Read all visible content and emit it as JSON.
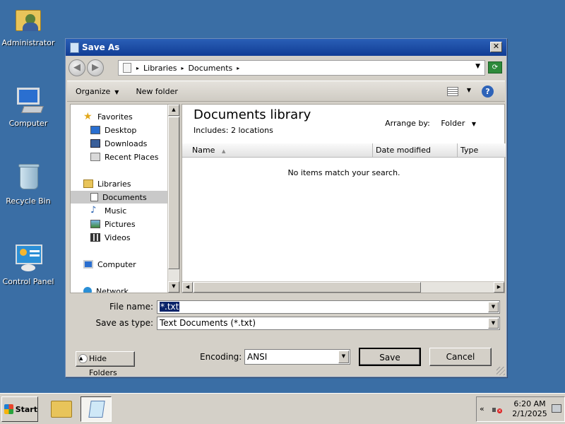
{
  "desktop": {
    "icons": [
      {
        "label": "Administrator",
        "icon": "user-folder-icon"
      },
      {
        "label": "Computer",
        "icon": "computer-icon"
      },
      {
        "label": "Recycle Bin",
        "icon": "recycle-bin-icon"
      },
      {
        "label": "Control Panel",
        "icon": "control-panel-icon"
      }
    ]
  },
  "dialog": {
    "title": "Save As",
    "close_glyph": "✕",
    "address": {
      "crumbs": [
        "Libraries",
        "Documents"
      ],
      "separator": "▸"
    },
    "toolbar": {
      "organize": "Organize",
      "new_folder": "New folder",
      "help_glyph": "?"
    },
    "nav": {
      "items": [
        {
          "label": "Favorites",
          "icon": "star-icon"
        },
        {
          "label": "Desktop",
          "icon": "desktop-icon"
        },
        {
          "label": "Downloads",
          "icon": "downloads-icon"
        },
        {
          "label": "Recent Places",
          "icon": "recent-places-icon"
        },
        {
          "label": "Libraries",
          "icon": "libraries-icon"
        },
        {
          "label": "Documents",
          "icon": "documents-icon",
          "selected": true
        },
        {
          "label": "Music",
          "icon": "music-icon"
        },
        {
          "label": "Pictures",
          "icon": "pictures-icon"
        },
        {
          "label": "Videos",
          "icon": "videos-icon"
        },
        {
          "label": "Computer",
          "icon": "computer-icon"
        },
        {
          "label": "Network",
          "icon": "network-icon"
        }
      ]
    },
    "content": {
      "title": "Documents library",
      "includes_label": "Includes:",
      "includes_link": "2 locations",
      "arrange_label": "Arrange by:",
      "arrange_value": "Folder",
      "columns": [
        "Name",
        "Date modified",
        "Type"
      ],
      "empty_message": "No items match your search."
    },
    "file_name_label": "File name:",
    "file_name_value": "*.txt",
    "save_type_label": "Save as type:",
    "save_type_value": "Text Documents (*.txt)",
    "hide_folders": "Hide Folders",
    "encoding_label": "Encoding:",
    "encoding_value": "ANSI",
    "save_button": "Save",
    "cancel_button": "Cancel"
  },
  "taskbar": {
    "start_label": "Start",
    "tray_chevron": "«",
    "time": "6:20 AM",
    "date": "2/1/2025"
  },
  "colors": {
    "desktop": "#3a6ea5",
    "titlebar": "#123d94",
    "selection": "#0a246a"
  }
}
